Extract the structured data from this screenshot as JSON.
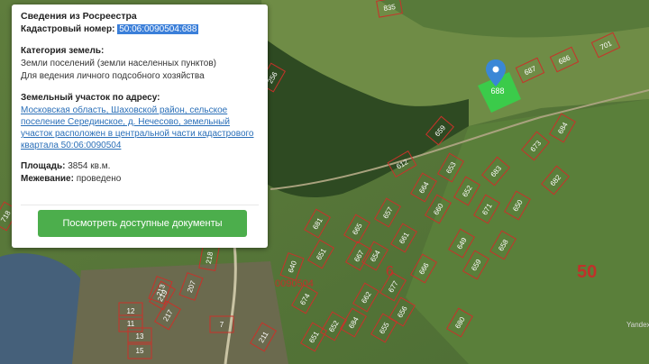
{
  "panel": {
    "title": "Сведения из Росреестра",
    "cadastral_label": "Кадастровый номер:",
    "cadastral_value": "50:06:0090504:688",
    "category_label": "Категория земель:",
    "category_line1": "Земли поселений (земли населенных пунктов)",
    "category_line2": "Для ведения личного подсобного хозяйства",
    "address_label": "Земельный участок по адресу:",
    "address_lines": [
      "Московская область, Шаховской район, сельское",
      "поселение Серединское, д. Нечесово, земельный",
      "участок расположен в центральной части кадастрового",
      "квартала 50:06:0090504"
    ],
    "area_label": "Площадь:",
    "area_value": "3854 кв.м.",
    "survey_label": "Межевание:",
    "survey_value": "проведено",
    "button_label": "Посмотреть доступные документы"
  },
  "map": {
    "region_label": "50",
    "district_label": "6",
    "quarter_label": "0090504",
    "selected_parcel_label": "688",
    "parcel_labels": [
      "835",
      "701",
      "686",
      "687",
      "659",
      "684",
      "673",
      "683",
      "682",
      "653",
      "664",
      "612",
      "652",
      "660",
      "657",
      "671",
      "661",
      "654",
      "665",
      "650",
      "658",
      "659",
      "651",
      "649",
      "667",
      "681",
      "640",
      "666",
      "674",
      "662",
      "677",
      "656",
      "684",
      "655",
      "680",
      "651",
      "652",
      "256",
      "219",
      "718",
      "12",
      "11",
      "13",
      "15",
      "213",
      "207",
      "217",
      "218",
      "211",
      "7"
    ],
    "watermark": "Yandex",
    "colors": {
      "selected_fill": "#35d14a",
      "marker": "#3a87d6",
      "parcel_outline": "#c8322a",
      "region_text": "#c0312a"
    }
  }
}
